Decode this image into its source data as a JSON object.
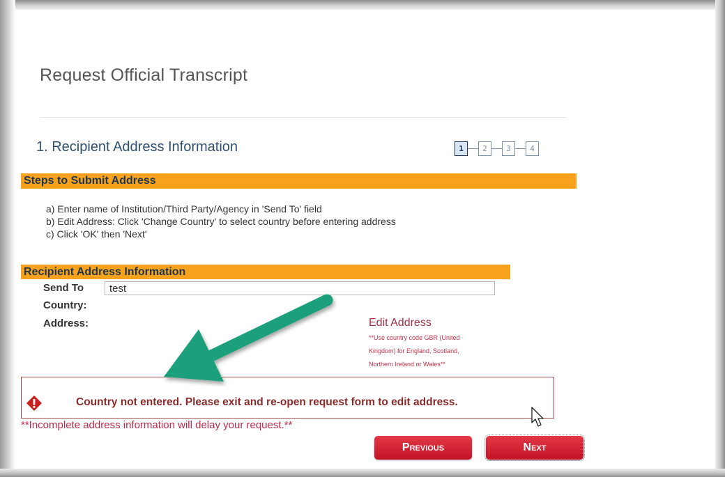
{
  "page": {
    "title": "Request Official Transcript"
  },
  "section": {
    "heading": "1. Recipient Address Information",
    "steps": [
      "1",
      "2",
      "3",
      "4"
    ],
    "active_step": 1
  },
  "steps_bar": {
    "label": "Steps to Submit Address"
  },
  "instructions": [
    "a) Enter name of Institution/Third Party/Agency in 'Send To' field",
    "b) Edit Address: Click 'Change Country' to select country before entering address",
    "c) Click 'OK' then 'Next'"
  ],
  "recipient_bar": {
    "label": "Recipient Address Information"
  },
  "form": {
    "send_to_label": "Send To",
    "send_to_value": "test",
    "country_label": "Country:",
    "address_label": "Address:",
    "edit_address_link": "Edit Address",
    "note_lines": [
      "**Use country code GBR (United",
      "Kingdom) for England, Scotland,",
      "Northern Ireland or Wales**"
    ]
  },
  "error": {
    "message": "Country not entered.  Please exit and re-open request form to edit address."
  },
  "warning": "**Incomplete address information will delay your request.**",
  "buttons": {
    "previous": "Previous",
    "next": "Next"
  },
  "colors": {
    "accent_bar": "#f6a21c",
    "button_red": "#d0182c",
    "heading_blue": "#2f4f6f",
    "error_red": "#8a2b2b",
    "arrow_green": "#1aa07c"
  },
  "icons": {
    "error": "error-diamond-icon",
    "annotation": "green-arrow-icon",
    "pointer": "mouse-cursor-icon"
  }
}
